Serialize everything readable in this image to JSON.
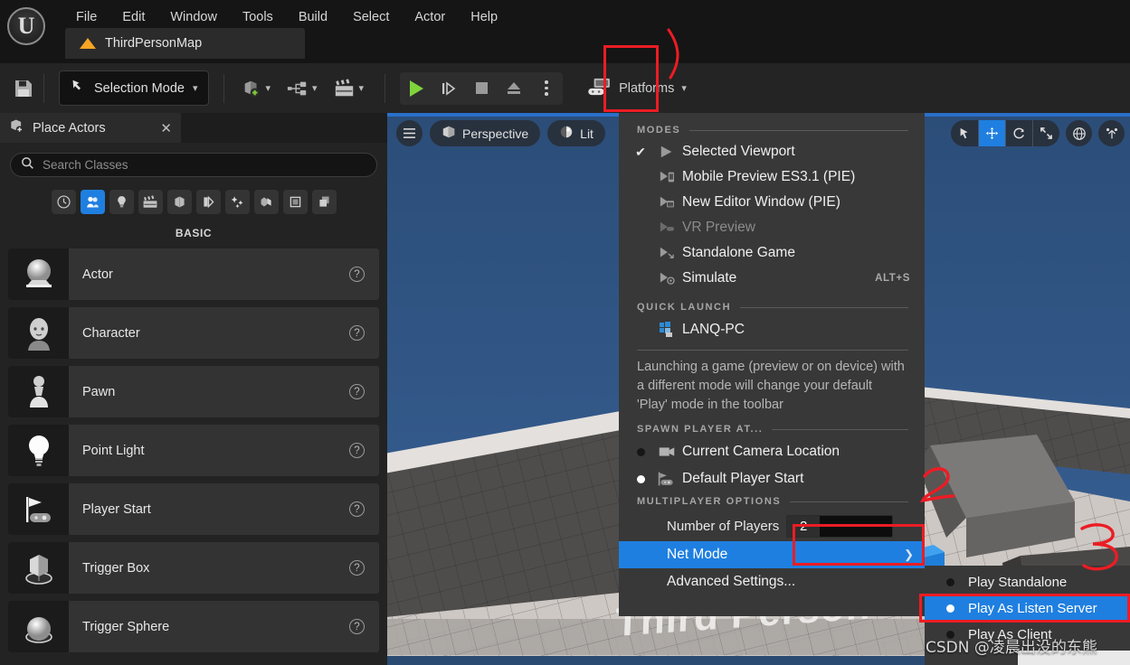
{
  "app": {
    "logo": "unreal-engine-logo",
    "menus": [
      "File",
      "Edit",
      "Window",
      "Tools",
      "Build",
      "Select",
      "Actor",
      "Help"
    ],
    "tab": {
      "label": "ThirdPersonMap",
      "icon": "level-map-icon"
    }
  },
  "toolbar": {
    "save_icon": "save-icon",
    "mode_label": "Selection Mode",
    "mode_icon": "cursor-select-icon",
    "groups": [
      {
        "icon": "add-actor-icon",
        "name": "add-actor-dropdown"
      },
      {
        "icon": "blueprints-icon",
        "name": "blueprints-dropdown"
      },
      {
        "icon": "cinematics-icon",
        "name": "cinematics-dropdown"
      }
    ],
    "play_buttons": [
      {
        "name": "play-button",
        "icon": "play-triangle-icon"
      },
      {
        "name": "skip-button",
        "icon": "step-forward-icon"
      },
      {
        "name": "stop-button",
        "icon": "stop-square-icon"
      },
      {
        "name": "eject-button",
        "icon": "eject-icon"
      },
      {
        "name": "play-options-button",
        "icon": "three-dots-vertical-icon"
      }
    ],
    "platforms_label": "Platforms",
    "platforms_icon": "platforms-gamepad-icon"
  },
  "place_actors": {
    "title": "Place Actors",
    "tab_icon": "place-actors-icon",
    "close_icon": "close-icon",
    "search": {
      "placeholder": "Search Classes",
      "value": "",
      "icon": "search-icon"
    },
    "categories": [
      {
        "name": "recently-placed",
        "icon": "clock-icon",
        "active": false
      },
      {
        "name": "basic",
        "icon": "basic-shapes-icon",
        "active": true
      },
      {
        "name": "lights",
        "icon": "light-bulb-icon",
        "active": false
      },
      {
        "name": "cinematic",
        "icon": "clapperboard-icon",
        "active": false
      },
      {
        "name": "visual-effects",
        "icon": "cube-icon",
        "active": false
      },
      {
        "name": "geometry",
        "icon": "bsp-icon",
        "active": false
      },
      {
        "name": "volumes",
        "icon": "sparkle-icon",
        "active": false
      },
      {
        "name": "all-classes",
        "icon": "boxes-icon",
        "active": false
      },
      {
        "name": "panel-8",
        "icon": "square-icon",
        "active": false
      },
      {
        "name": "panel-9",
        "icon": "layers-icon",
        "active": false
      }
    ],
    "section_title": "BASIC",
    "items": [
      {
        "label": "Actor",
        "icon": "actor-sphere-icon"
      },
      {
        "label": "Character",
        "icon": "character-head-icon"
      },
      {
        "label": "Pawn",
        "icon": "pawn-icon"
      },
      {
        "label": "Point Light",
        "icon": "point-light-bulb-icon"
      },
      {
        "label": "Player Start",
        "icon": "player-start-flag-icon"
      },
      {
        "label": "Trigger Box",
        "icon": "trigger-box-icon"
      },
      {
        "label": "Trigger Sphere",
        "icon": "trigger-sphere-icon"
      }
    ],
    "help_icon": "help-question-icon"
  },
  "viewport": {
    "menu_icon": "viewport-hamburger-icon",
    "perspective_label": "Perspective",
    "perspective_icon": "cube-perspective-icon",
    "lit_label": "Lit",
    "lit_icon": "lit-sphere-icon",
    "gizmos": [
      {
        "name": "select-tool",
        "icon": "cursor-arrow-icon",
        "selected": false
      },
      {
        "name": "translate-tool",
        "icon": "move-arrows-icon",
        "selected": true
      },
      {
        "name": "rotate-tool",
        "icon": "rotate-icon",
        "selected": false
      },
      {
        "name": "scale-tool",
        "icon": "scale-icon",
        "selected": false
      }
    ],
    "extras": [
      {
        "name": "world-coordinate-toggle",
        "icon": "globe-icon"
      },
      {
        "name": "snap-toggle",
        "icon": "snap-axis-icon"
      }
    ],
    "level_text": "Third Person"
  },
  "play_menu": {
    "modes_header": "MODES",
    "modes": [
      {
        "label": "Selected Viewport",
        "icon": "play-viewport-icon",
        "checked": true,
        "disabled": false,
        "shortcut": ""
      },
      {
        "label": "Mobile Preview ES3.1 (PIE)",
        "icon": "play-mobile-icon",
        "checked": false,
        "disabled": false,
        "shortcut": ""
      },
      {
        "label": "New Editor Window (PIE)",
        "icon": "play-window-icon",
        "checked": false,
        "disabled": false,
        "shortcut": ""
      },
      {
        "label": "VR Preview",
        "icon": "play-vr-icon",
        "checked": false,
        "disabled": true,
        "shortcut": ""
      },
      {
        "label": "Standalone Game",
        "icon": "play-standalone-icon",
        "checked": false,
        "disabled": false,
        "shortcut": ""
      },
      {
        "label": "Simulate",
        "icon": "play-simulate-icon",
        "checked": false,
        "disabled": false,
        "shortcut": "ALT+S"
      }
    ],
    "quick_launch_header": "QUICK LAUNCH",
    "quick_launch": {
      "label": "LANQ-PC",
      "icon": "windows-pc-icon"
    },
    "help_text": "Launching a game (preview or on device) with a different mode will change your default 'Play' mode in the toolbar",
    "spawn_header": "SPAWN PLAYER AT...",
    "spawn_options": [
      {
        "label": "Current Camera Location",
        "icon": "camera-icon",
        "selected": false
      },
      {
        "label": "Default Player Start",
        "icon": "player-start-flag-icon",
        "selected": true
      }
    ],
    "multiplayer_header": "MULTIPLAYER OPTIONS",
    "number_of_players": {
      "label": "Number of Players",
      "value": "2"
    },
    "net_mode": {
      "label": "Net Mode",
      "highlighted": true,
      "arrow_icon": "chevron-right-icon"
    },
    "advanced_settings": {
      "label": "Advanced Settings..."
    }
  },
  "net_mode_submenu": {
    "items": [
      {
        "label": "Play Standalone",
        "selected": false
      },
      {
        "label": "Play As Listen Server",
        "selected": true
      },
      {
        "label": "Play As Client",
        "selected": false
      }
    ]
  },
  "annotations": {
    "watermark": "CSDN @凌晨出没的东熊",
    "color": "#ec1c24",
    "marks": [
      "curve-to-play-options",
      "digit-2-near-cube",
      "digit-3-near-cube"
    ]
  }
}
